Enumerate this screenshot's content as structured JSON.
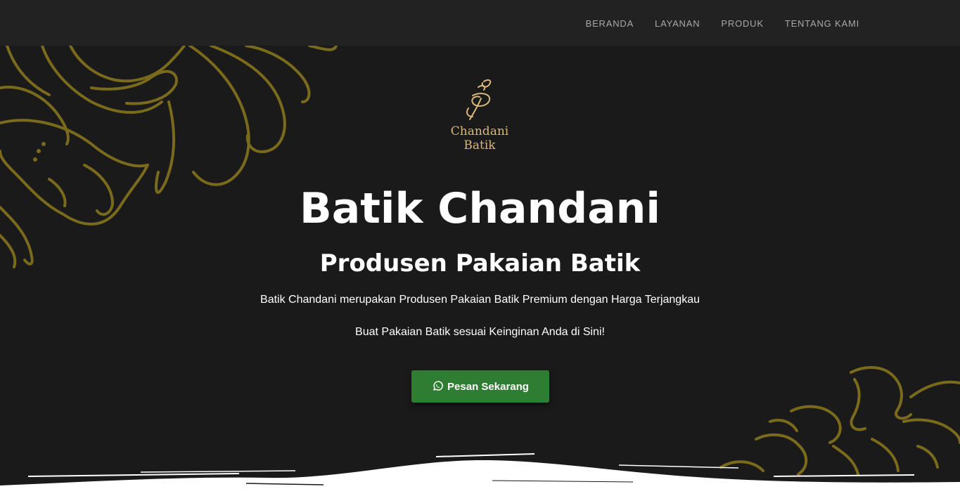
{
  "nav": {
    "items": [
      {
        "label": "BERANDA"
      },
      {
        "label": "LAYANAN"
      },
      {
        "label": "PRODUK"
      },
      {
        "label": "TENTANG KAMI"
      }
    ]
  },
  "logo": {
    "line1": "Chandani",
    "line2": "Batik"
  },
  "hero": {
    "title": "Batik Chandani",
    "subtitle": "Produsen Pakaian Batik",
    "description1": "Batik Chandani merupakan Produsen Pakaian Batik Premium dengan Harga Terjangkau",
    "description2": "Buat Pakaian Batik sesuai Keinginan Anda di Sini!",
    "cta_label": "Pesan Sekarang",
    "cta_icon": "whatsapp-icon"
  },
  "colors": {
    "background": "#1a1a1a",
    "navbar": "#222222",
    "accent_gold": "#7a6a1c",
    "logo_gold": "#d9b77a",
    "cta_green": "#2e7d32"
  }
}
